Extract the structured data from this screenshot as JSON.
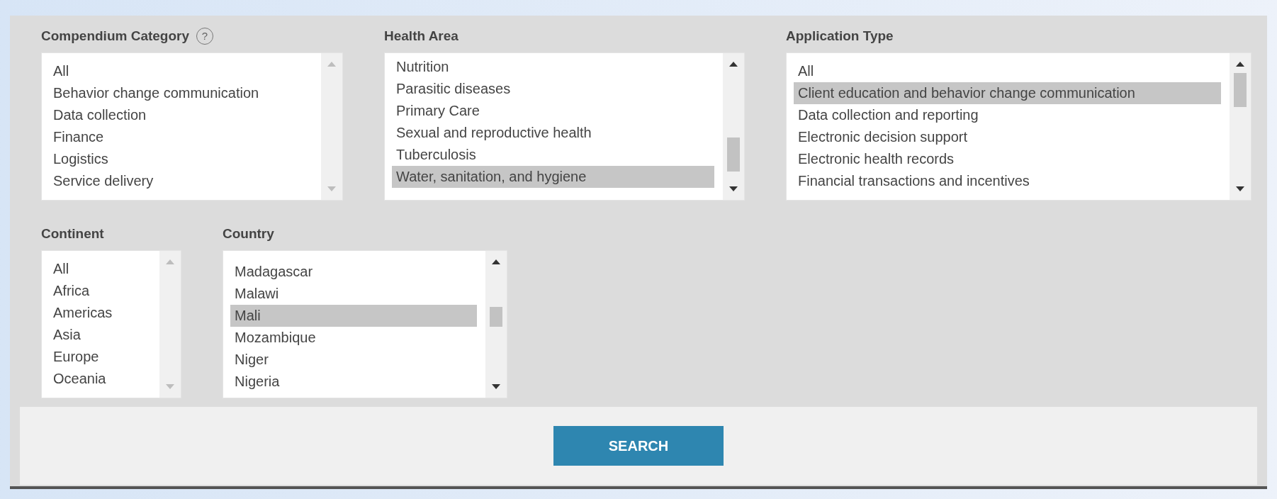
{
  "filters_top": [
    {
      "label": "Compendium Category",
      "help": "?",
      "items": [
        {
          "label": "All",
          "selected": false
        },
        {
          "label": "Behavior change communication",
          "selected": false
        },
        {
          "label": "Data collection",
          "selected": false
        },
        {
          "label": "Finance",
          "selected": false
        },
        {
          "label": "Logistics",
          "selected": false
        },
        {
          "label": "Service delivery",
          "selected": false
        }
      ]
    },
    {
      "label": "Health Area",
      "items": [
        {
          "label": "Nutrition",
          "selected": false
        },
        {
          "label": "Parasitic diseases",
          "selected": false
        },
        {
          "label": "Primary Care",
          "selected": false
        },
        {
          "label": "Sexual and reproductive health",
          "selected": false
        },
        {
          "label": "Tuberculosis",
          "selected": false
        },
        {
          "label": "Water, sanitation, and hygiene",
          "selected": true
        }
      ]
    },
    {
      "label": "Application Type",
      "items": [
        {
          "label": "All",
          "selected": false
        },
        {
          "label": "Client education and behavior change communication",
          "selected": true
        },
        {
          "label": "Data collection and reporting",
          "selected": false
        },
        {
          "label": "Electronic decision support",
          "selected": false
        },
        {
          "label": "Electronic health records",
          "selected": false
        },
        {
          "label": "Financial transactions and incentives",
          "selected": false
        }
      ]
    }
  ],
  "filters_bottom": [
    {
      "label": "Continent",
      "items": [
        {
          "label": "All",
          "selected": false
        },
        {
          "label": "Africa",
          "selected": false
        },
        {
          "label": "Americas",
          "selected": false
        },
        {
          "label": "Asia",
          "selected": false
        },
        {
          "label": "Europe",
          "selected": false
        },
        {
          "label": "Oceania",
          "selected": false
        }
      ]
    },
    {
      "label": "Country",
      "items": [
        {
          "label": "Madagascar",
          "selected": false
        },
        {
          "label": "Malawi",
          "selected": false
        },
        {
          "label": "Mali",
          "selected": true
        },
        {
          "label": "Mozambique",
          "selected": false
        },
        {
          "label": "Niger",
          "selected": false
        },
        {
          "label": "Nigeria",
          "selected": false
        }
      ]
    }
  ],
  "search_button": "SEARCH"
}
